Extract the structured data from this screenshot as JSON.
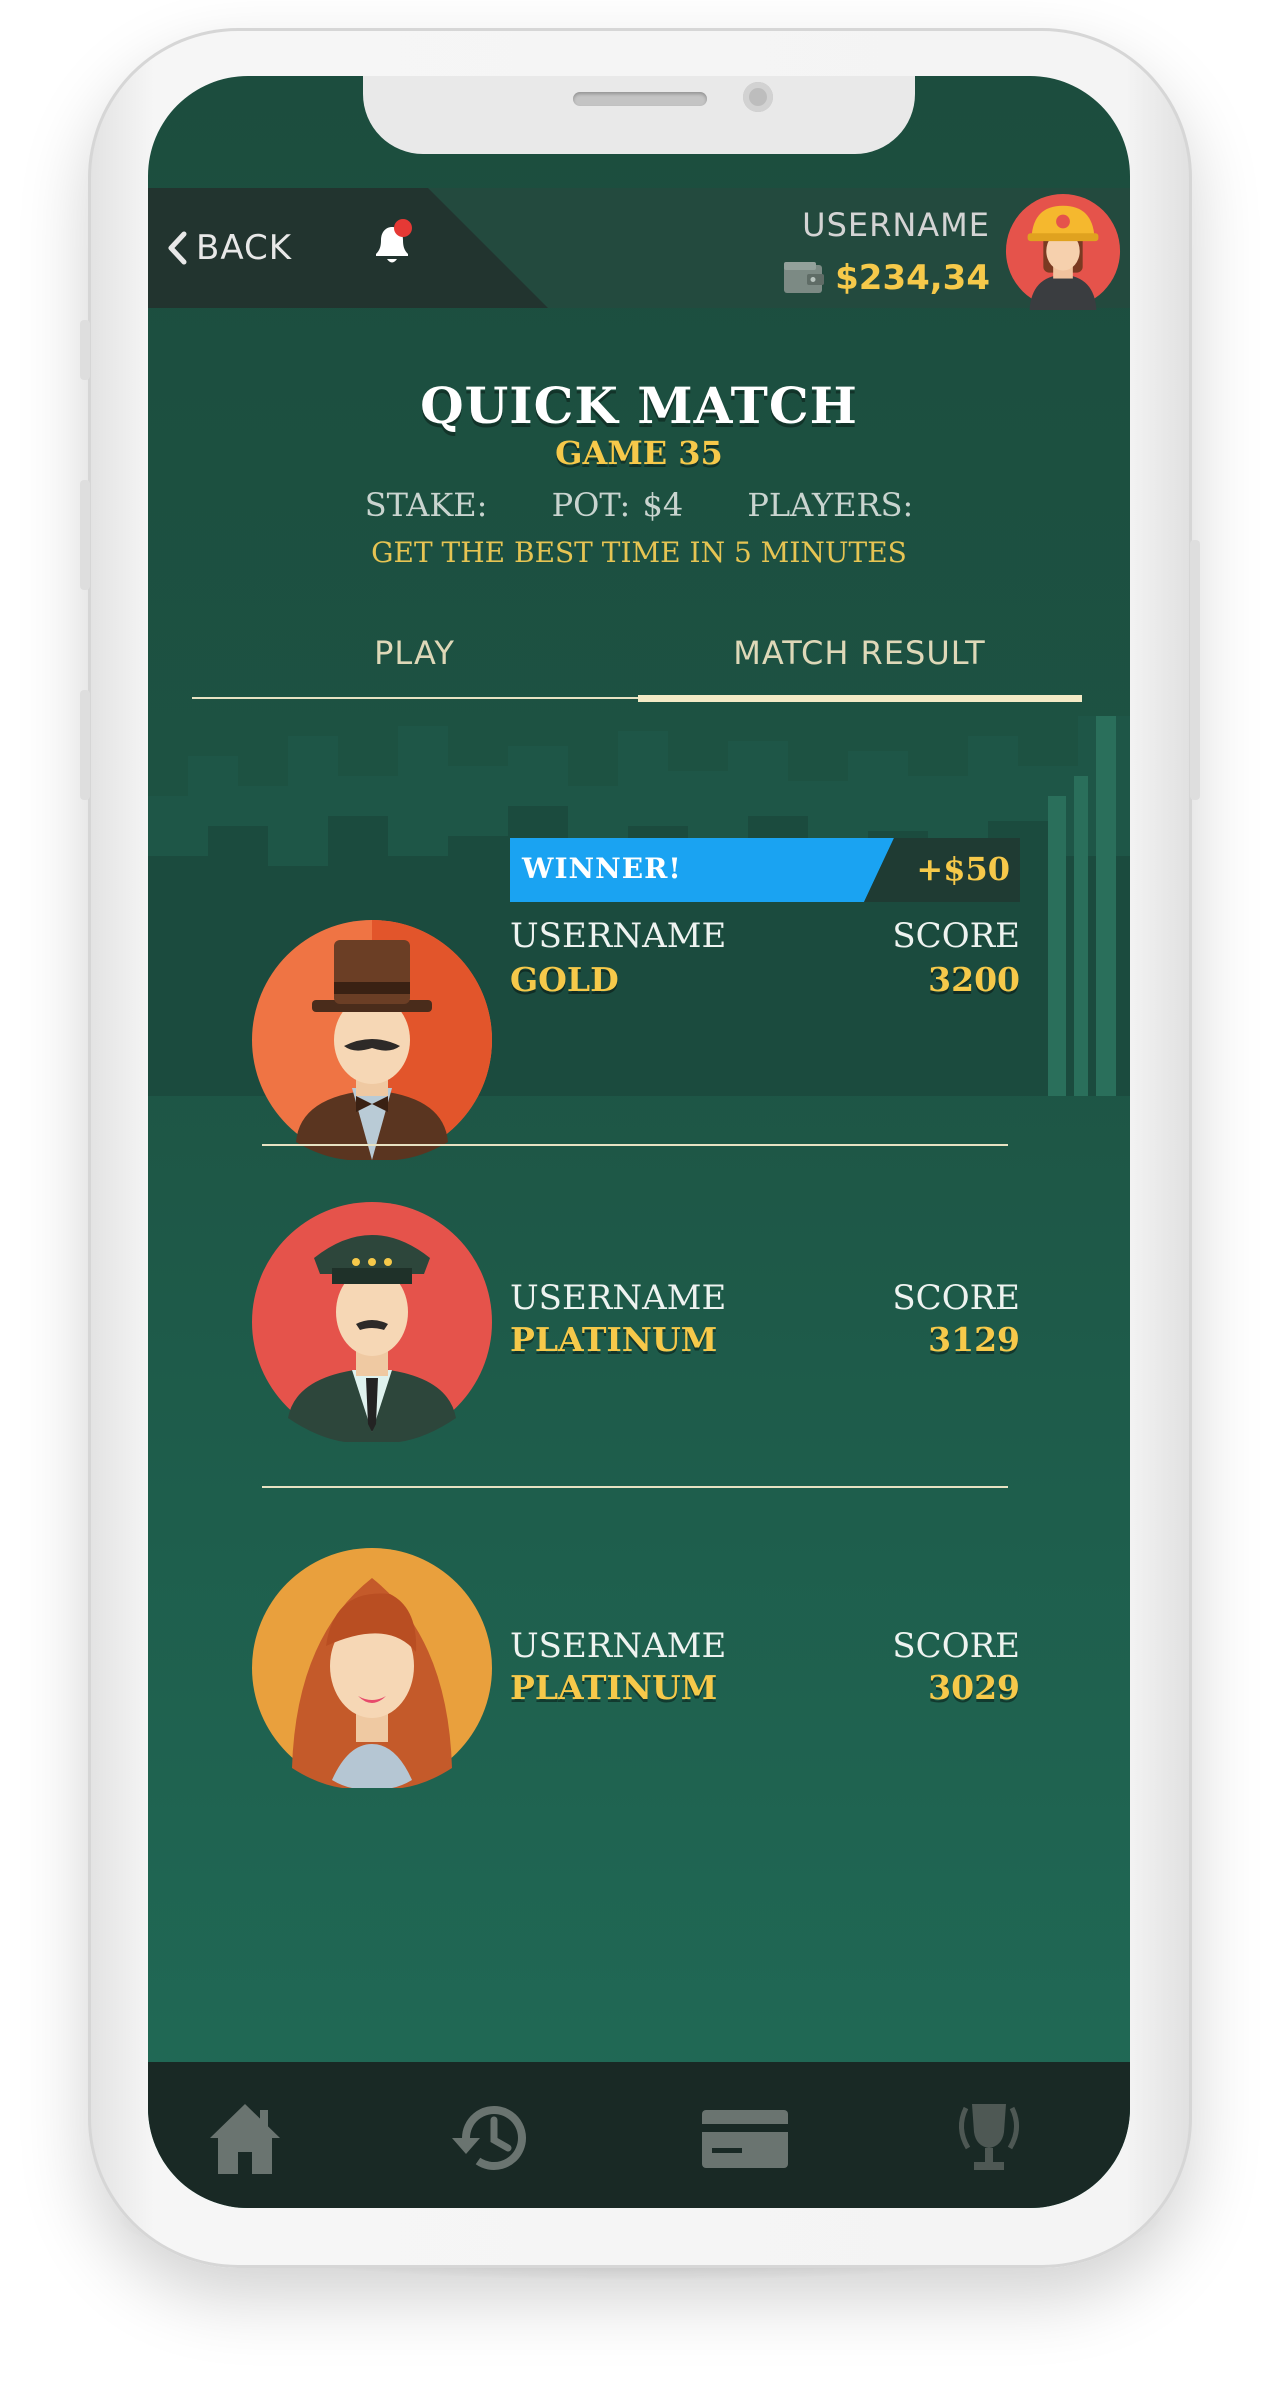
{
  "header": {
    "back_label": "BACK",
    "username": "USERNAME",
    "balance": "$234,34",
    "icons": [
      "chevron-left-icon",
      "bell-icon",
      "wallet-icon"
    ]
  },
  "match": {
    "title": "QUICK MATCH",
    "subtitle": "GAME 35",
    "stake_label": "STAKE:",
    "pot_label": "POT: $4",
    "players_label": "PLAYERS:",
    "objective": "GET THE BEST TIME IN 5 MINUTES"
  },
  "tabs": [
    {
      "label": "PLAY",
      "active": false
    },
    {
      "label": "MATCH RESULT",
      "active": true
    }
  ],
  "results": [
    {
      "username": "USERNAME",
      "rank": "GOLD",
      "score_label": "SCORE",
      "score": "3200",
      "winner_label": "WINNER!",
      "prize": "+$50"
    },
    {
      "username": "USERNAME",
      "rank": "PLATINUM",
      "score_label": "SCORE",
      "score": "3129"
    },
    {
      "username": "USERNAME",
      "rank": "PLATINUM",
      "score_label": "SCORE",
      "score": "3029"
    }
  ],
  "bottom_nav": [
    "home-icon",
    "history-icon",
    "card-icon",
    "trophy-icon"
  ],
  "colors": {
    "background": "#1d5343",
    "accent_gold": "#f6c94a",
    "winner_blue": "#1aa3f2",
    "nav_bar": "#192925"
  }
}
